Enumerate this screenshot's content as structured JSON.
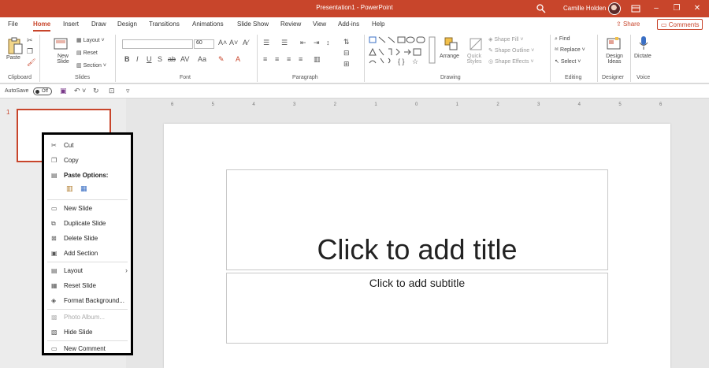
{
  "titlebar": {
    "title": "Presentation1  -  PowerPoint",
    "user": "Camille Holden",
    "search_icon": "search-icon",
    "minimize": "–",
    "restore": "❐",
    "close": "✕"
  },
  "tabs": [
    "File",
    "Home",
    "Insert",
    "Draw",
    "Design",
    "Transitions",
    "Animations",
    "Slide Show",
    "Review",
    "View",
    "Add-ins",
    "Help"
  ],
  "active_tab": "Home",
  "share_label": "Share",
  "comments_label": "Comments",
  "ribbon": {
    "groups": [
      "Clipboard",
      "Slides",
      "Font",
      "Paragraph",
      "Drawing",
      "Editing",
      "Designer",
      "Voice"
    ],
    "paste": "Paste",
    "new_slide": "New Slide",
    "layout": "Layout",
    "reset": "Reset",
    "section": "Section",
    "font_size": "60",
    "arrange": "Arrange",
    "quick_styles": "Quick Styles",
    "shape_fill": "Shape Fill",
    "shape_outline": "Shape Outline",
    "shape_effects": "Shape Effects",
    "find": "Find",
    "replace": "Replace",
    "select": "Select",
    "design_ideas": "Design Ideas",
    "dictate": "Dictate"
  },
  "qat": {
    "autosave": "AutoSave",
    "toggle": "Off"
  },
  "slide": {
    "number": "1",
    "title_placeholder": "Click to add title",
    "subtitle_placeholder": "Click to add subtitle"
  },
  "ruler_ticks": [
    "6",
    "5",
    "4",
    "3",
    "2",
    "1",
    "0",
    "1",
    "2",
    "3",
    "4",
    "5",
    "6"
  ],
  "context_menu": [
    {
      "label": "Cut",
      "icon": "scissors-icon"
    },
    {
      "label": "Copy",
      "icon": "copy-icon"
    },
    {
      "label": "Paste Options:",
      "icon": "paste-icon"
    },
    {
      "label": "New Slide",
      "icon": "new-slide-icon"
    },
    {
      "label": "Duplicate Slide",
      "icon": "duplicate-icon"
    },
    {
      "label": "Delete Slide",
      "icon": "delete-icon"
    },
    {
      "label": "Add Section",
      "icon": "section-icon"
    },
    {
      "label": "Layout",
      "icon": "layout-icon"
    },
    {
      "label": "Reset Slide",
      "icon": "reset-icon"
    },
    {
      "label": "Format Background...",
      "icon": "format-bg-icon"
    },
    {
      "label": "Photo Album...",
      "icon": "photo-icon"
    },
    {
      "label": "Hide Slide",
      "icon": "hide-icon"
    },
    {
      "label": "New Comment",
      "icon": "comment-icon"
    }
  ],
  "colors": {
    "accent": "#c8452b"
  }
}
